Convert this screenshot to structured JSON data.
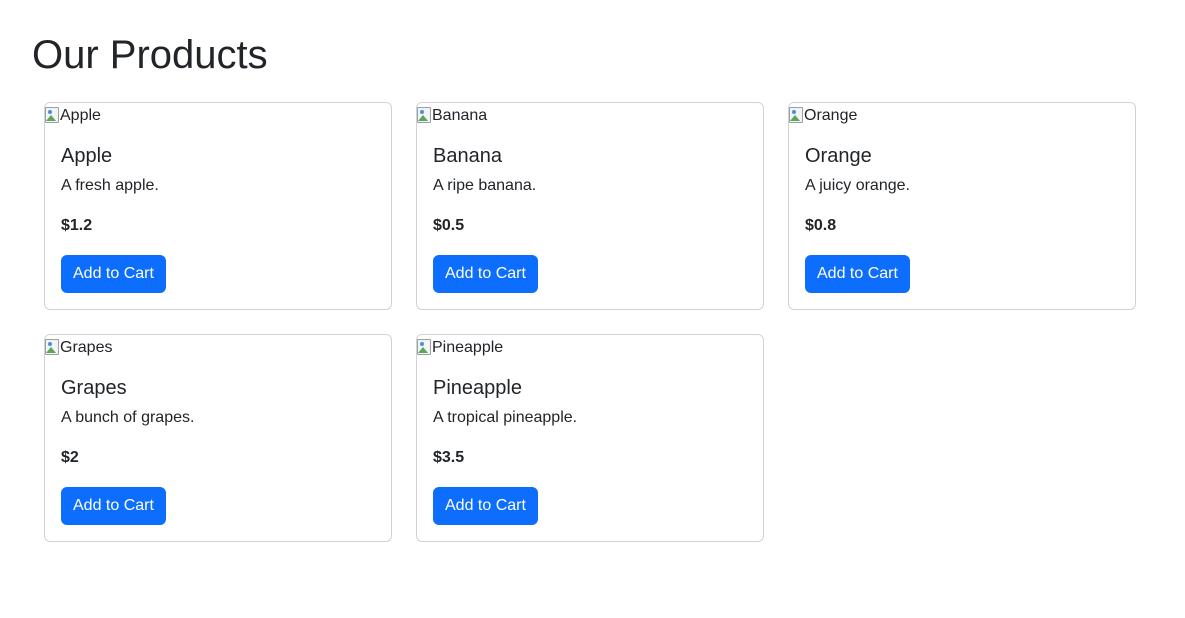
{
  "page": {
    "title": "Our Products"
  },
  "products": [
    {
      "image_alt": "Apple",
      "name": "Apple",
      "description": "A fresh apple.",
      "price": "$1.2",
      "button_label": "Add to Cart"
    },
    {
      "image_alt": "Banana",
      "name": "Banana",
      "description": "A ripe banana.",
      "price": "$0.5",
      "button_label": "Add to Cart"
    },
    {
      "image_alt": "Orange",
      "name": "Orange",
      "description": "A juicy orange.",
      "price": "$0.8",
      "button_label": "Add to Cart"
    },
    {
      "image_alt": "Grapes",
      "name": "Grapes",
      "description": "A bunch of grapes.",
      "price": "$2",
      "button_label": "Add to Cart"
    },
    {
      "image_alt": "Pineapple",
      "name": "Pineapple",
      "description": "A tropical pineapple.",
      "price": "$3.5",
      "button_label": "Add to Cart"
    }
  ],
  "colors": {
    "button_bg": "#0d6efd",
    "button_text": "#ffffff",
    "text": "#212529",
    "card_border": "#d0d3d6"
  },
  "icons": {
    "broken_image": "broken-image-icon"
  }
}
